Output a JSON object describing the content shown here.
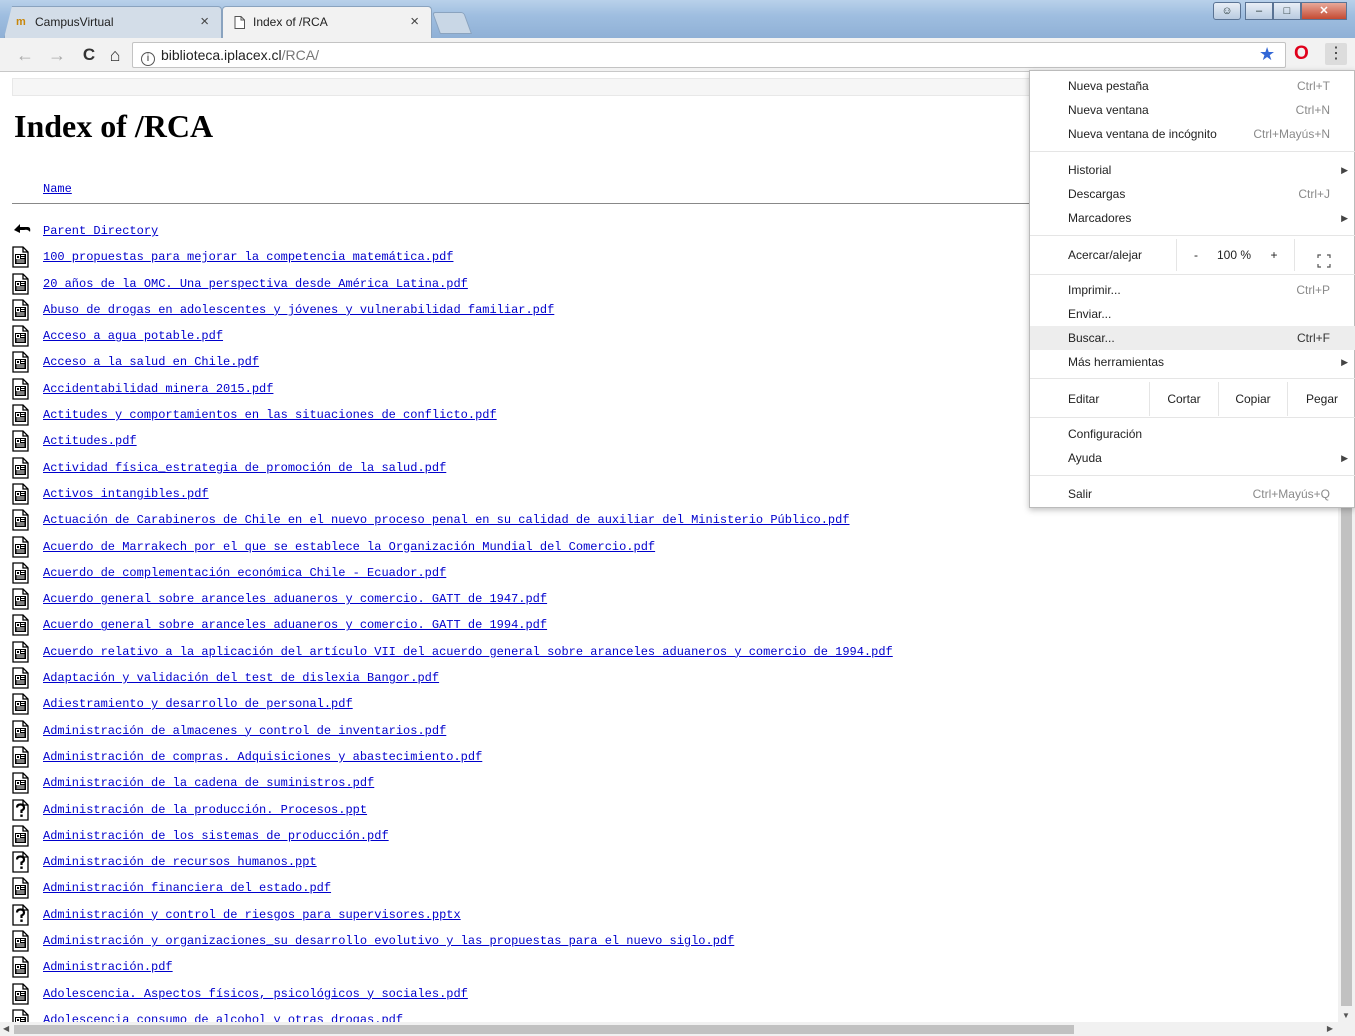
{
  "browser": {
    "tabs": [
      {
        "title": "CampusVirtual",
        "icon": "campus-icon",
        "close": "×"
      },
      {
        "title": "Index of /RCA",
        "icon": "page-icon",
        "close": "×"
      }
    ],
    "address": {
      "info": "i",
      "host": "biblioteca.iplacex.cl",
      "path": "/RCA/"
    },
    "nav": {
      "back": "←",
      "forward": "→",
      "reload": "C",
      "home": "⌂"
    }
  },
  "page": {
    "title": "Index of /RCA",
    "column_name": "Name",
    "files": [
      {
        "name": "Parent Directory",
        "icon": "back-arrow-icon"
      },
      {
        "name": "100 propuestas para mejorar la competencia matemática.pdf",
        "icon": "pdf-file-icon"
      },
      {
        "name": "20 años de la OMC. Una perspectiva desde América Latina.pdf",
        "icon": "pdf-file-icon"
      },
      {
        "name": "Abuso de drogas en adolescentes y jóvenes y vulnerabilidad familiar.pdf",
        "icon": "pdf-file-icon"
      },
      {
        "name": "Acceso a agua potable.pdf",
        "icon": "pdf-file-icon"
      },
      {
        "name": "Acceso a la salud en Chile.pdf",
        "icon": "pdf-file-icon"
      },
      {
        "name": "Accidentabilidad minera 2015.pdf",
        "icon": "pdf-file-icon"
      },
      {
        "name": "Actitudes y comportamientos en las situaciones de conflicto.pdf",
        "icon": "pdf-file-icon"
      },
      {
        "name": "Actitudes.pdf",
        "icon": "pdf-file-icon"
      },
      {
        "name": "Actividad física_estrategia de promoción de la salud.pdf",
        "icon": "pdf-file-icon"
      },
      {
        "name": "Activos intangibles.pdf",
        "icon": "pdf-file-icon"
      },
      {
        "name": "Actuación de Carabineros de Chile en el nuevo proceso penal en su calidad de auxiliar del Ministerio Público.pdf",
        "icon": "pdf-file-icon"
      },
      {
        "name": "Acuerdo de Marrakech por el que se establece la Organización Mundial del Comercio.pdf",
        "icon": "pdf-file-icon"
      },
      {
        "name": "Acuerdo de complementación económica Chile - Ecuador.pdf",
        "icon": "pdf-file-icon"
      },
      {
        "name": "Acuerdo general sobre aranceles aduaneros y comercio. GATT de 1947.pdf",
        "icon": "pdf-file-icon"
      },
      {
        "name": "Acuerdo general sobre aranceles aduaneros y comercio. GATT de 1994.pdf",
        "icon": "pdf-file-icon"
      },
      {
        "name": "Acuerdo relativo a la aplicación del artículo VII del acuerdo general sobre aranceles aduaneros y comercio de 1994.pdf",
        "icon": "pdf-file-icon"
      },
      {
        "name": "Adaptación y validación del test de dislexia Bangor.pdf",
        "icon": "pdf-file-icon"
      },
      {
        "name": "Adiestramiento y desarrollo de personal.pdf",
        "icon": "pdf-file-icon"
      },
      {
        "name": "Administración de almacenes y control de inventarios.pdf",
        "icon": "pdf-file-icon"
      },
      {
        "name": "Administración de compras. Adquisiciones y abastecimiento.pdf",
        "icon": "pdf-file-icon"
      },
      {
        "name": "Administración de la cadena de suministros.pdf",
        "icon": "pdf-file-icon"
      },
      {
        "name": "Administración de la producción. Procesos.ppt",
        "icon": "unknown-file-icon"
      },
      {
        "name": "Administración de los sistemas de producción.pdf",
        "icon": "pdf-file-icon"
      },
      {
        "name": "Administración de recursos humanos.ppt",
        "icon": "unknown-file-icon"
      },
      {
        "name": "Administración financiera del estado.pdf",
        "icon": "pdf-file-icon"
      },
      {
        "name": "Administración y control de riesgos para supervisores.pptx",
        "icon": "unknown-file-icon"
      },
      {
        "name": "Administración y organizaciones_su desarrollo evolutivo y las propuestas para el nuevo siglo.pdf",
        "icon": "pdf-file-icon"
      },
      {
        "name": "Administración.pdf",
        "icon": "pdf-file-icon"
      },
      {
        "name": "Adolescencia. Aspectos físicos, psicológicos y sociales.pdf",
        "icon": "pdf-file-icon"
      },
      {
        "name": "Adolescencia consumo de alcohol y otras drogas.pdf",
        "icon": "pdf-file-icon"
      }
    ]
  },
  "menu": {
    "new_tab": {
      "label": "Nueva pestaña",
      "shortcut": "Ctrl+T"
    },
    "new_window": {
      "label": "Nueva ventana",
      "shortcut": "Ctrl+N"
    },
    "incognito": {
      "label": "Nueva ventana de incógnito",
      "shortcut": "Ctrl+Mayús+N"
    },
    "history": {
      "label": "Historial"
    },
    "downloads": {
      "label": "Descargas",
      "shortcut": "Ctrl+J"
    },
    "bookmarks": {
      "label": "Marcadores"
    },
    "zoom": {
      "label": "Acercar/alejar",
      "minus": "-",
      "value": "100 %",
      "plus": "+"
    },
    "print": {
      "label": "Imprimir...",
      "shortcut": "Ctrl+P"
    },
    "cast": {
      "label": "Enviar..."
    },
    "find": {
      "label": "Buscar...",
      "shortcut": "Ctrl+F"
    },
    "more_tools": {
      "label": "Más herramientas"
    },
    "edit": {
      "label": "Editar",
      "cut": "Cortar",
      "copy": "Copiar",
      "paste": "Pegar"
    },
    "settings": {
      "label": "Configuración"
    },
    "help": {
      "label": "Ayuda"
    },
    "exit": {
      "label": "Salir",
      "shortcut": "Ctrl+Mayús+Q"
    }
  }
}
